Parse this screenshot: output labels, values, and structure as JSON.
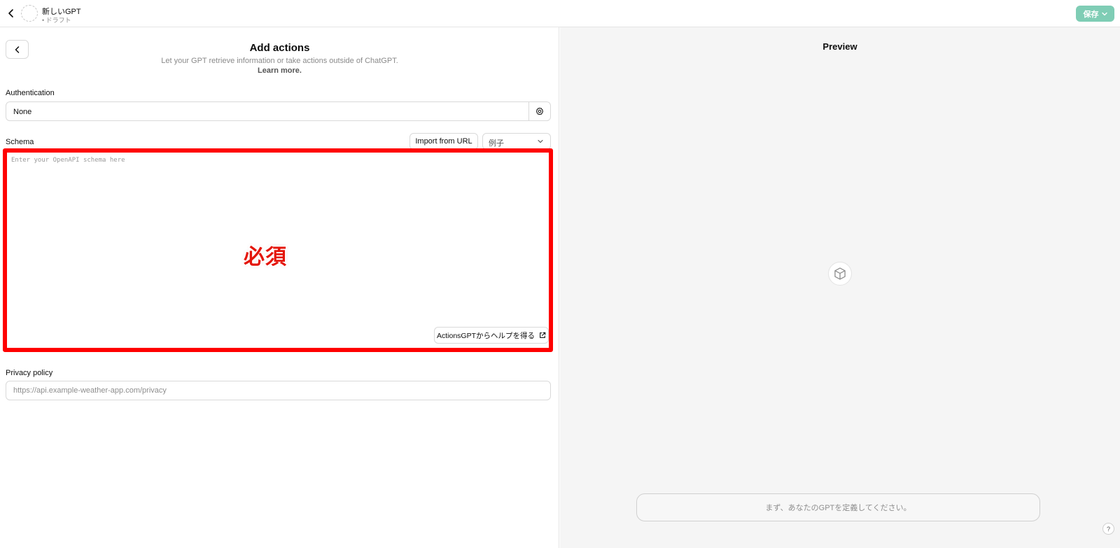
{
  "topbar": {
    "gpt_name": "新しいGPT",
    "gpt_status": "• ドラフト",
    "save_label": "保存"
  },
  "editor": {
    "title": "Add actions",
    "subtitle": "Let your GPT retrieve information or take actions outside of ChatGPT.",
    "learn_more": "Learn more.",
    "authentication": {
      "label": "Authentication",
      "value": "None"
    },
    "schema": {
      "label": "Schema",
      "import_label": "Import from URL",
      "example_select": "例子",
      "placeholder": "Enter your OpenAPI schema here",
      "value": "",
      "annotation": "必須",
      "help_button": "ActionsGPTからヘルプを得る"
    },
    "privacy": {
      "label": "Privacy policy",
      "placeholder": "https://api.example-weather-app.com/privacy",
      "value": ""
    }
  },
  "preview": {
    "title": "Preview",
    "prompt": "まず、あなたのGPTを定義してください。",
    "help": "?"
  },
  "colors": {
    "save_button_bg": "#7fcdb5",
    "highlight_border": "#ff0000",
    "annotation_text": "#e4160c",
    "preview_bg": "#f5f5f5"
  },
  "icons": [
    "chevron-left-icon",
    "gear-icon",
    "chevron-down-icon",
    "external-link-icon",
    "cube-icon"
  ]
}
